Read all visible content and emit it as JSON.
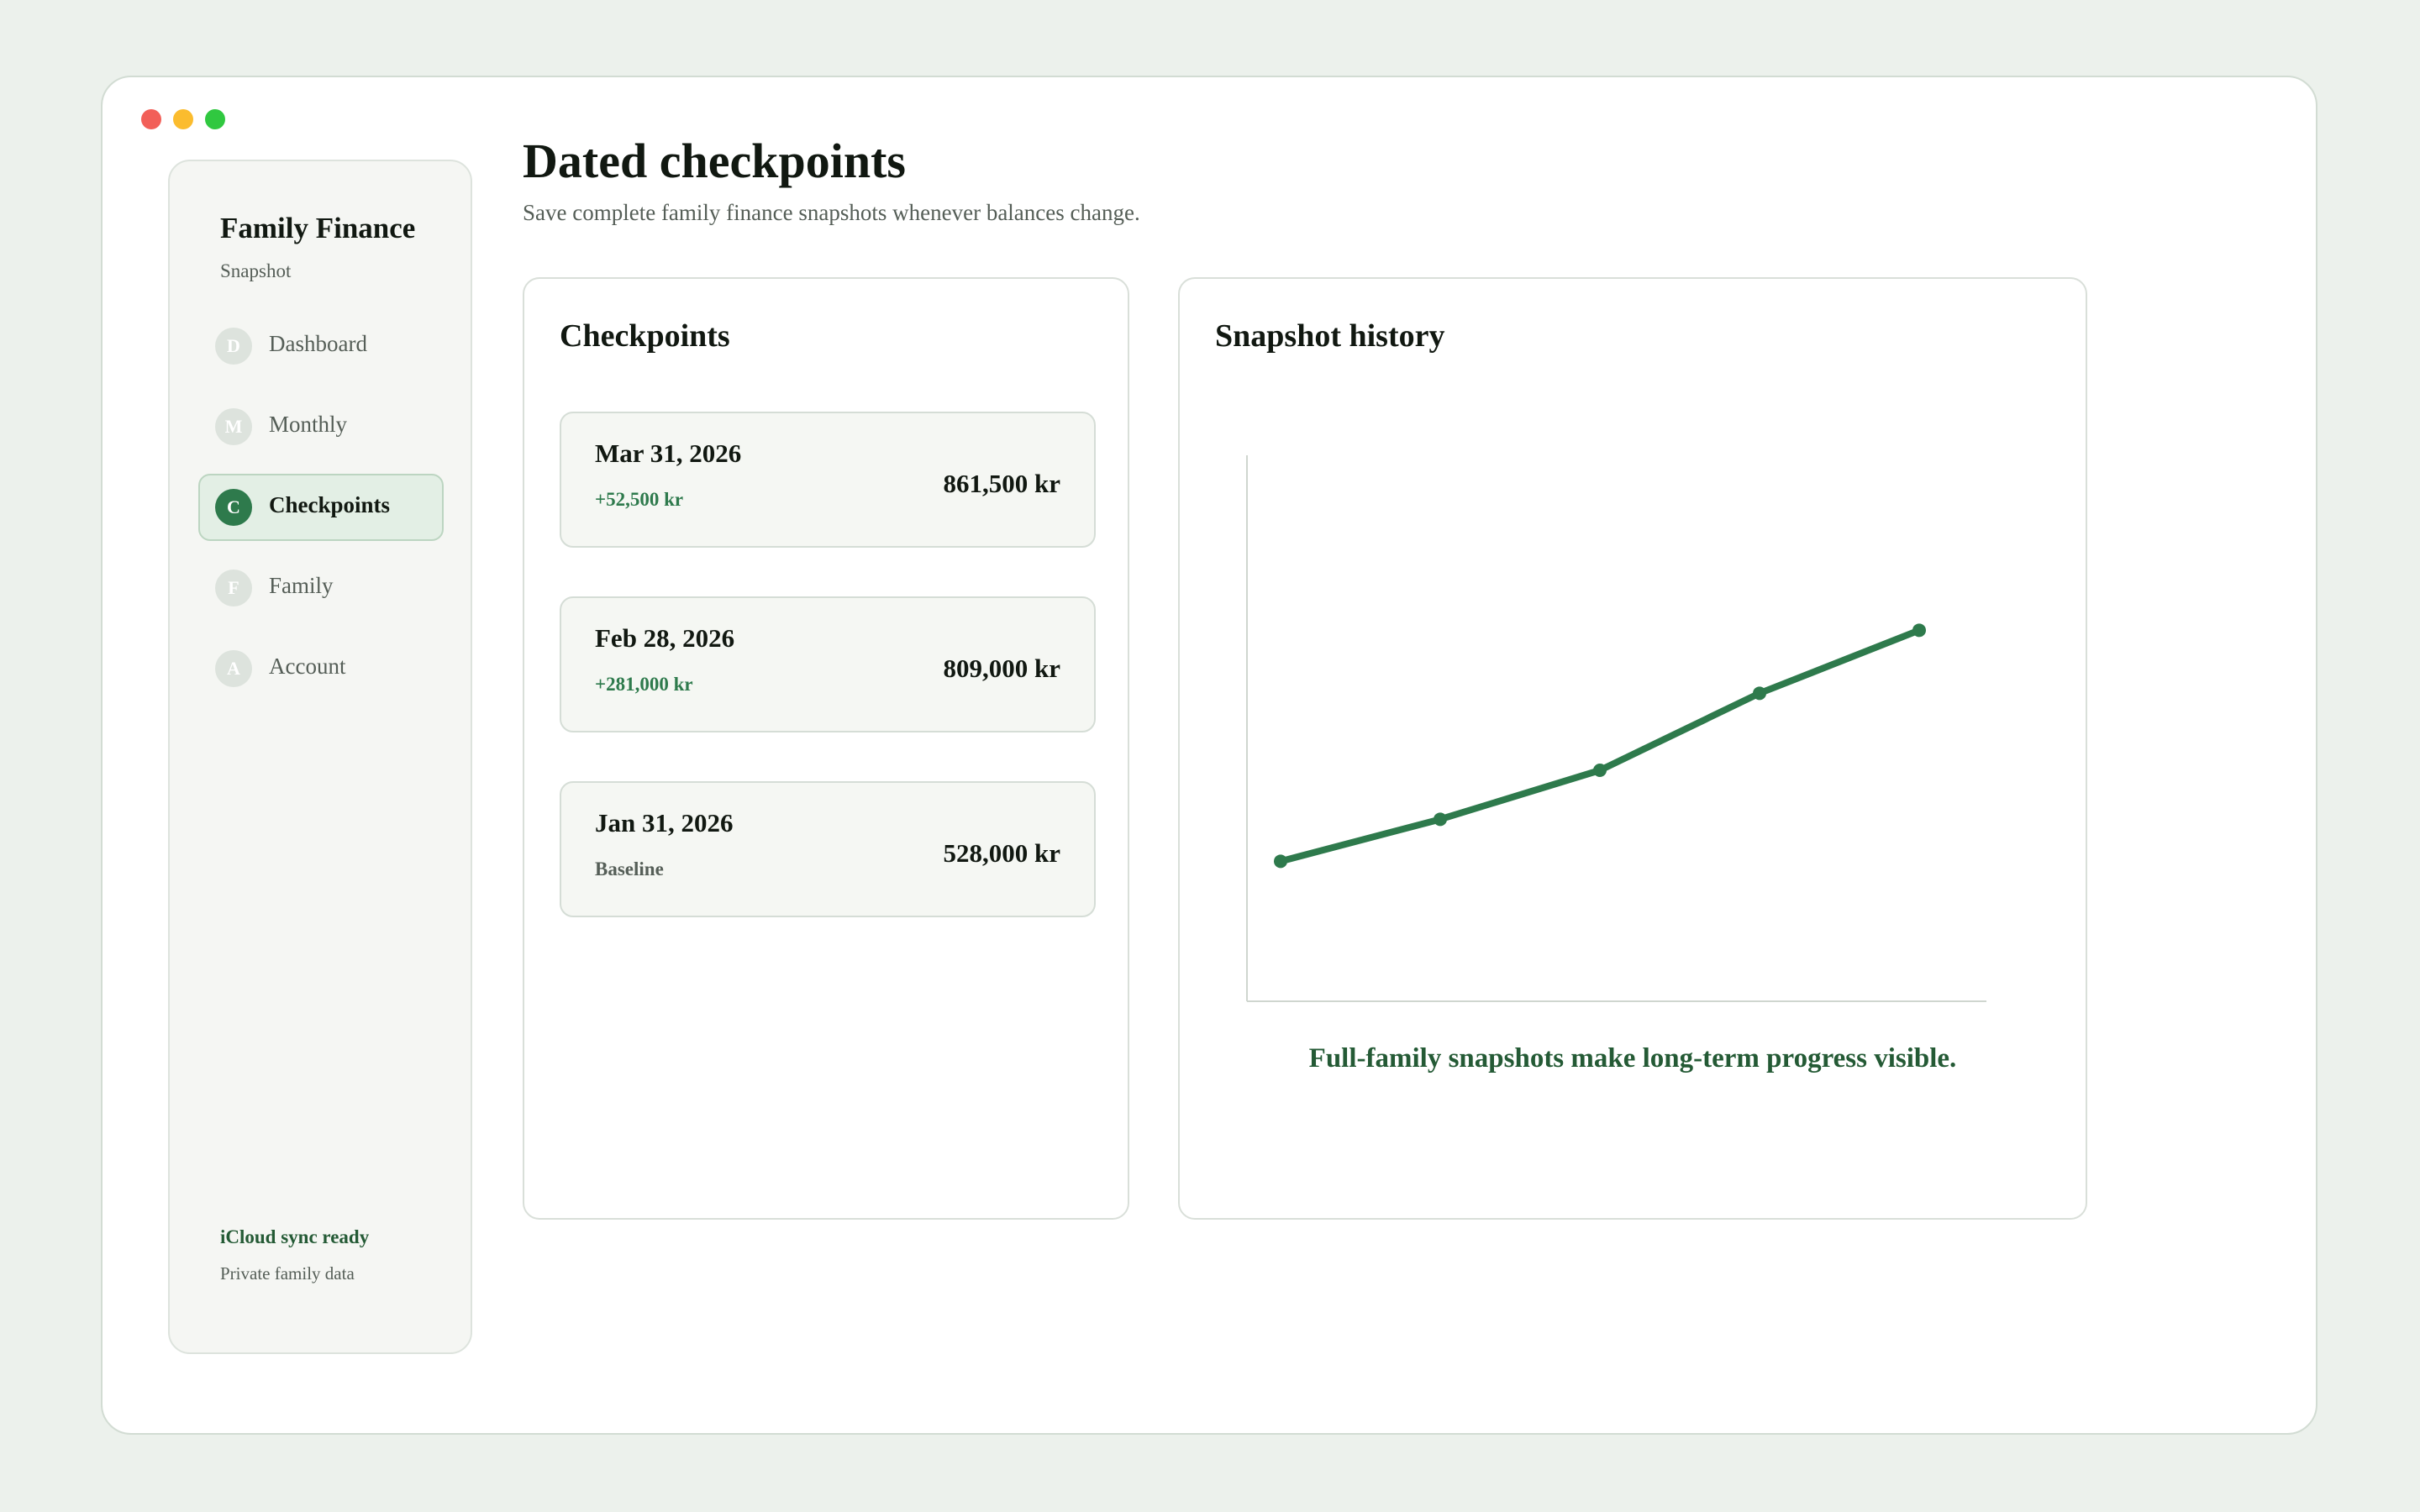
{
  "window": {
    "controls": [
      "close",
      "minimize",
      "zoom"
    ]
  },
  "sidebar": {
    "title": "Family Finance",
    "subtitle": "Snapshot",
    "items": [
      {
        "letter": "D",
        "label": "Dashboard",
        "active": false
      },
      {
        "letter": "M",
        "label": "Monthly",
        "active": false
      },
      {
        "letter": "C",
        "label": "Checkpoints",
        "active": true
      },
      {
        "letter": "F",
        "label": "Family",
        "active": false
      },
      {
        "letter": "A",
        "label": "Account",
        "active": false
      }
    ],
    "footer": {
      "status": "iCloud sync ready",
      "note": "Private family data"
    }
  },
  "header": {
    "title": "Dated checkpoints",
    "subtitle": "Save complete family finance snapshots whenever balances change."
  },
  "checkpoints": {
    "title": "Checkpoints",
    "items": [
      {
        "date": "Mar 31, 2026",
        "delta": "+52,500 kr",
        "amount": "861,500 kr"
      },
      {
        "date": "Feb 28, 2026",
        "delta": "+281,000 kr",
        "amount": "809,000 kr"
      },
      {
        "date": "Jan 31, 2026",
        "delta": "Baseline",
        "amount": "528,000 kr"
      }
    ]
  },
  "history": {
    "title": "Snapshot history",
    "caption": "Full-family snapshots make long-term progress visible."
  },
  "chart_data": {
    "type": "line",
    "x": [
      1,
      2,
      3,
      4,
      5
    ],
    "values": [
      1.0,
      1.3,
      1.65,
      2.2,
      2.65
    ],
    "ylim": [
      0,
      3.9
    ],
    "xlabel": "",
    "ylabel": "",
    "grid": false,
    "color": "#2e7a4c"
  },
  "colors": {
    "accent": "#2e7a4c",
    "accent_dark": "#245a35",
    "background": "#ecf1ec"
  }
}
